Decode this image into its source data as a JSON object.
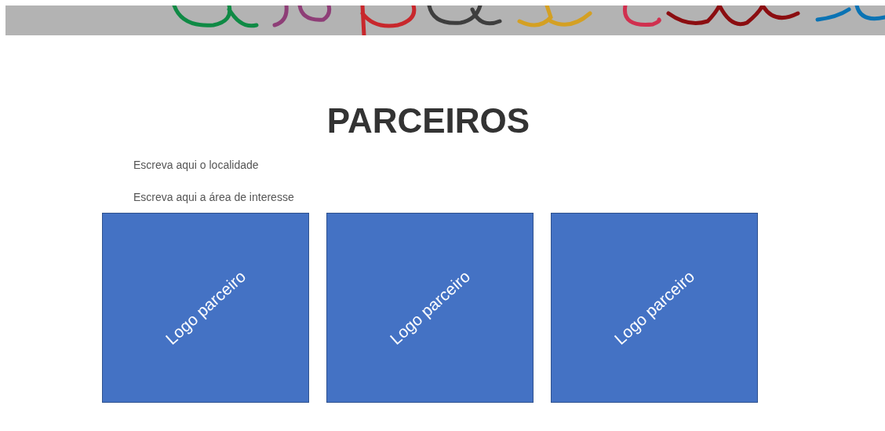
{
  "title": "PARCEIROS",
  "filters": [
    {
      "placeholder": "Escreva aqui o localidade"
    },
    {
      "placeholder": "Escreva aqui a área de interesse"
    }
  ],
  "partners": [
    {
      "label": "Logo parceiro"
    },
    {
      "label": "Logo parceiro"
    },
    {
      "label": "Logo parceiro"
    }
  ]
}
